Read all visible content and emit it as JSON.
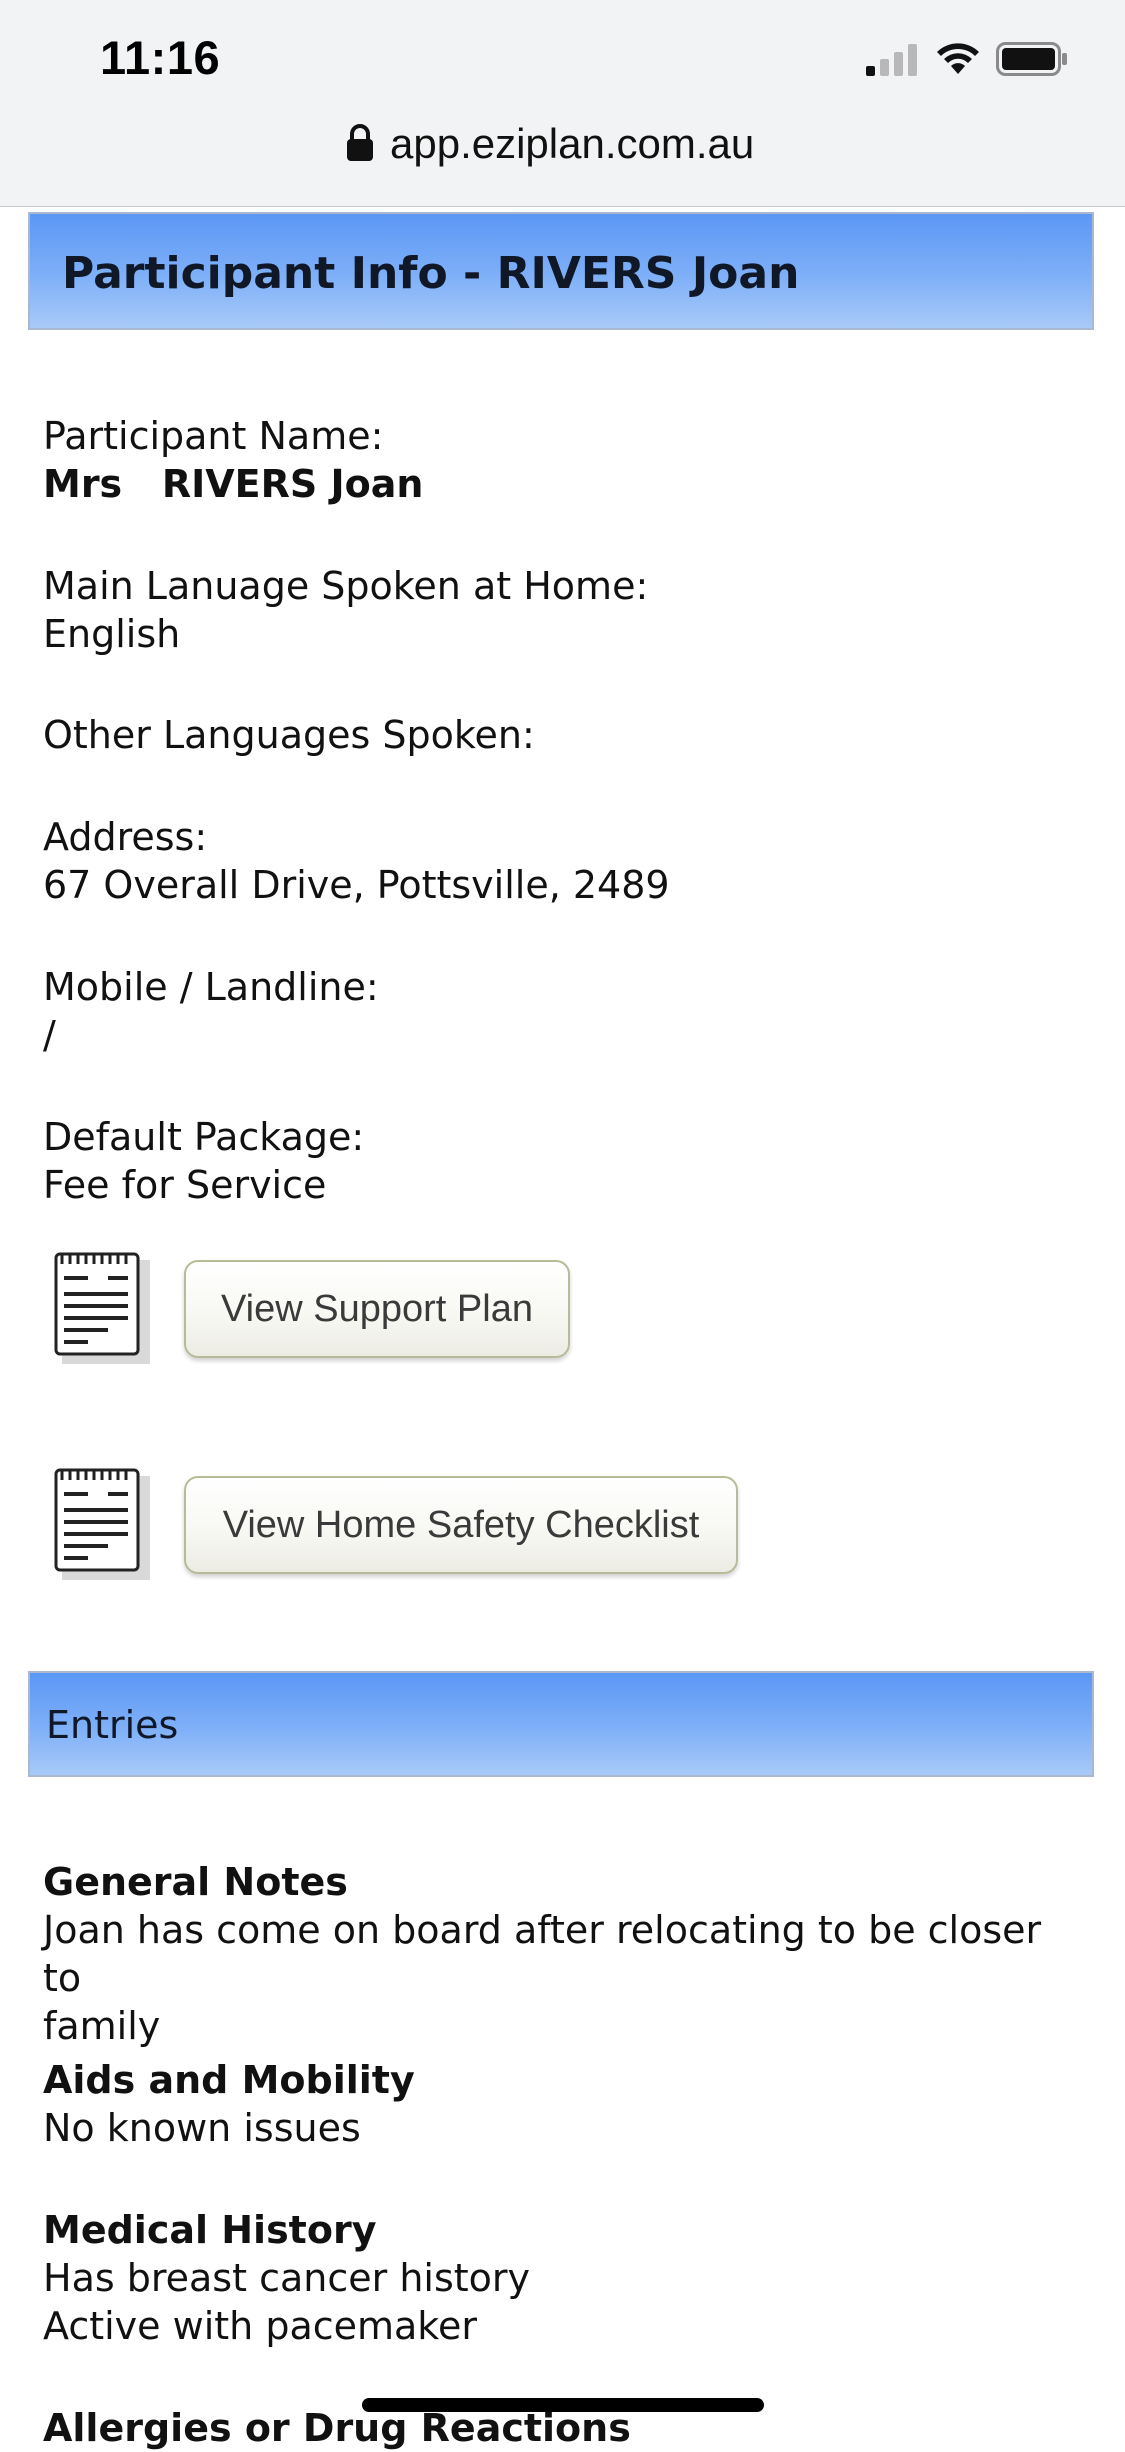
{
  "status_bar": {
    "time": "11:16"
  },
  "browser": {
    "url": "app.eziplan.com.au"
  },
  "header": {
    "title": "Participant Info - RIVERS Joan"
  },
  "fields": {
    "name_label": "Participant Name:",
    "name_value": "Mrs   RIVERS Joan",
    "language_label": "Main Lanuage Spoken at Home:",
    "language_value": "English",
    "other_languages_label": "Other Languages Spoken:",
    "address_label": "Address:",
    "address_value": "67 Overall Drive, Pottsville, 2489",
    "phone_label": "Mobile / Landline:",
    "phone_value": "/",
    "package_label": "Default Package:",
    "package_value": "Fee for Service"
  },
  "buttons": {
    "support_plan": "View Support Plan",
    "home_safety": "View Home Safety Checklist"
  },
  "entries": {
    "heading": "Entries",
    "general_notes_title": "General Notes",
    "general_notes_line1": "Joan has come on board after relocating to be closer to",
    "general_notes_line2": "family",
    "aids_title": "Aids and Mobility",
    "aids_text": "No known issues",
    "medical_title": "Medical History",
    "medical_line1": "Has breast cancer history",
    "medical_line2": "Active with pacemaker",
    "allergies_title": "Allergies or Drug Reactions"
  },
  "icons": {
    "signal": "cellular-signal-icon",
    "wifi": "wifi-icon",
    "battery": "battery-icon",
    "lock": "lock-icon",
    "document": "document-icon"
  }
}
